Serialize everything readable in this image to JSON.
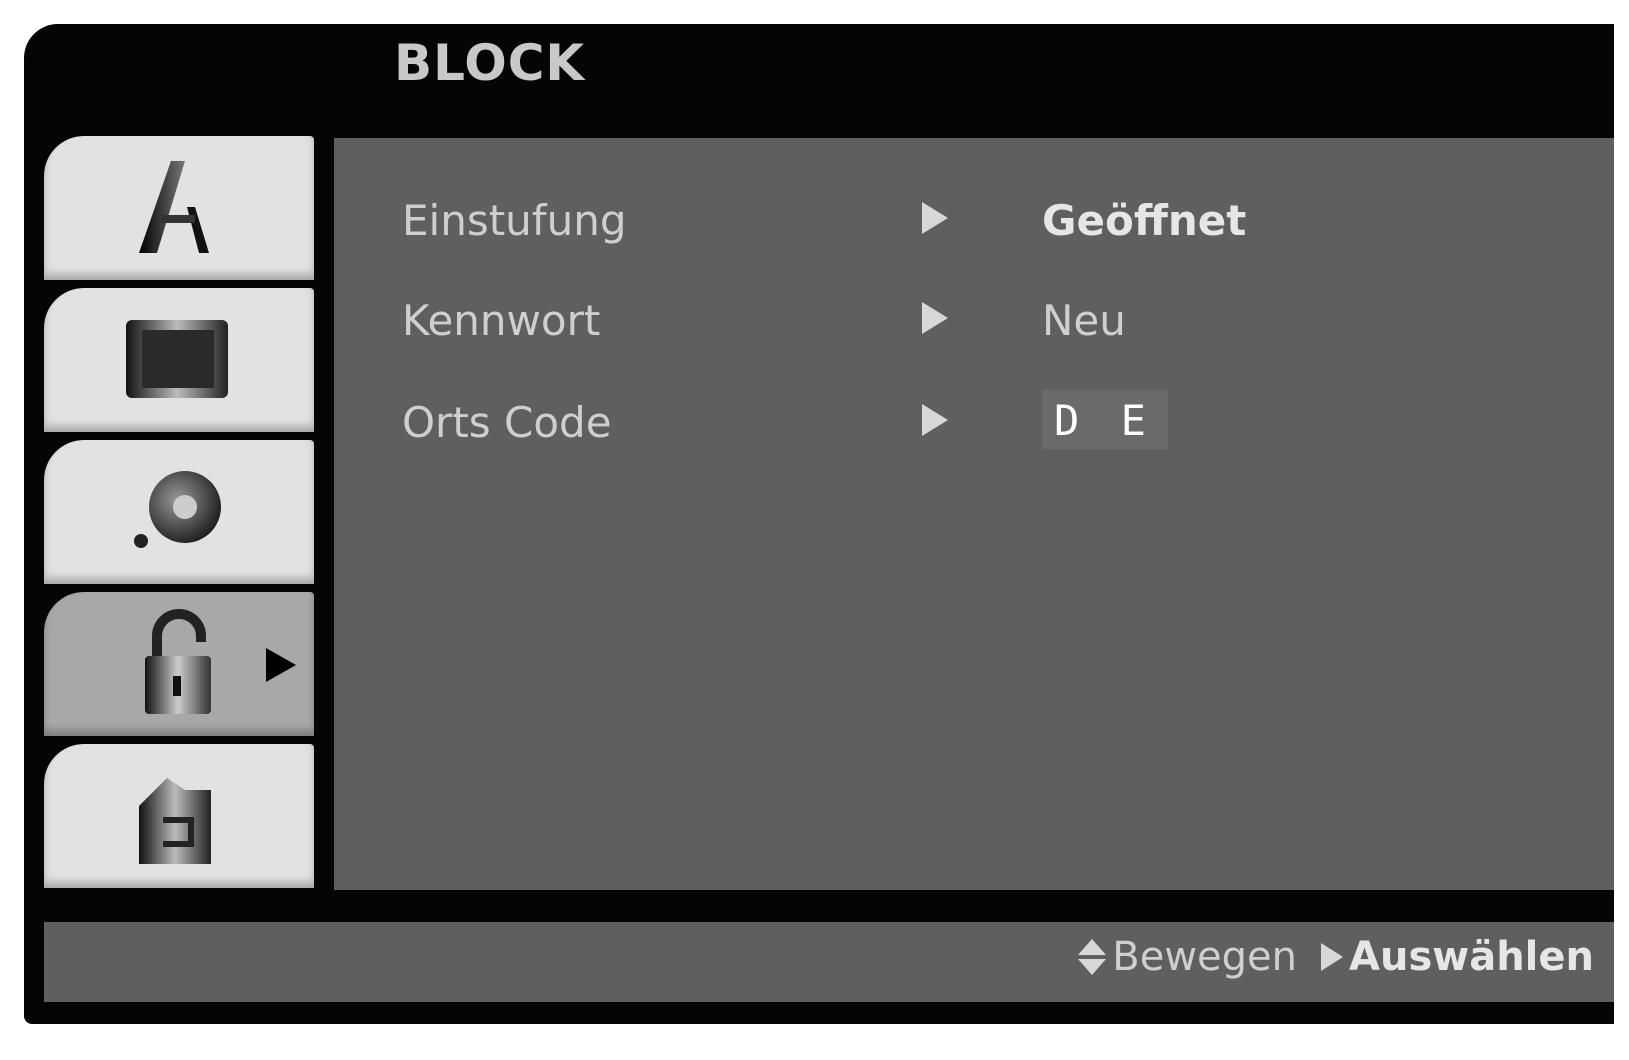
{
  "menu": {
    "title": "BLOCK"
  },
  "sidebar": {
    "tabs": [
      {
        "icon": "language-icon",
        "active": false
      },
      {
        "icon": "display-icon",
        "active": false
      },
      {
        "icon": "audio-icon",
        "active": false
      },
      {
        "icon": "lock-icon",
        "active": true
      },
      {
        "icon": "others-icon",
        "active": false
      }
    ]
  },
  "settings": [
    {
      "label": "Einstufung",
      "value": "Geöffnet"
    },
    {
      "label": "Kennwort",
      "value": "Neu"
    },
    {
      "label": "Orts Code",
      "value": "D E"
    }
  ],
  "footer": {
    "move_label": "Bewegen",
    "select_label": "Auswählen"
  }
}
